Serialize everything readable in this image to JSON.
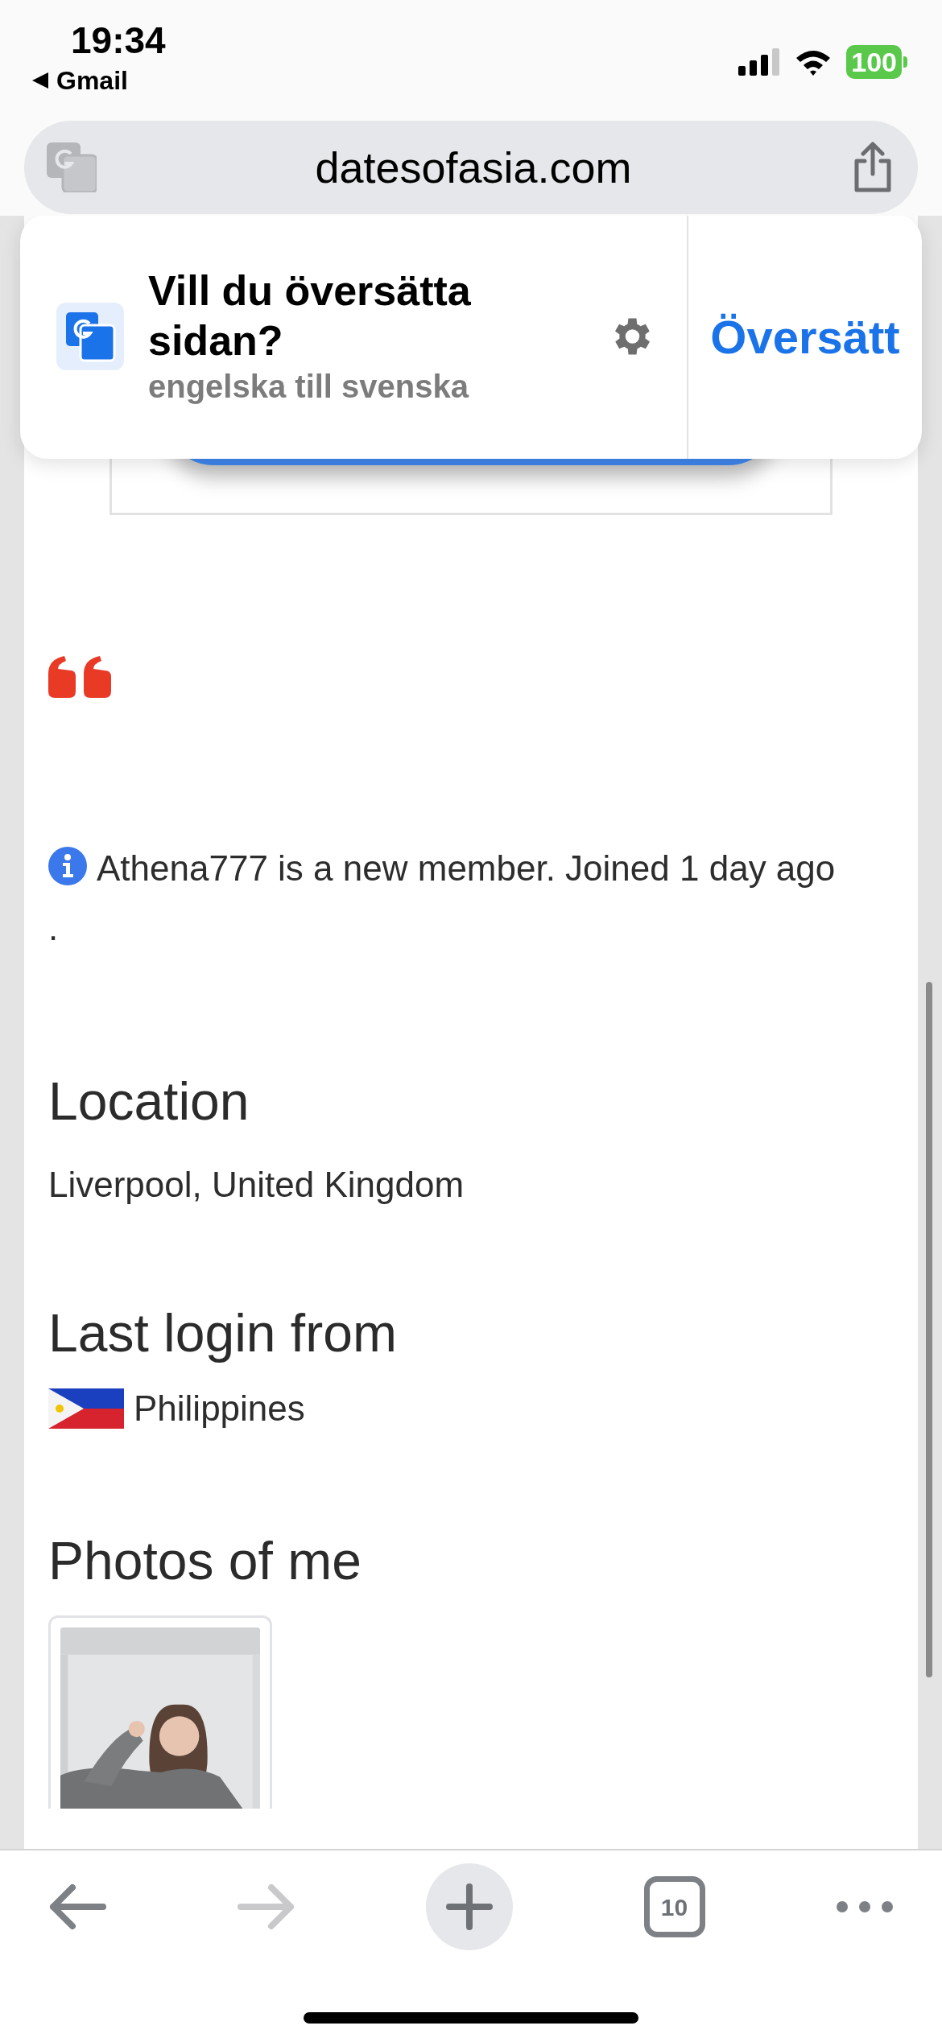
{
  "status_bar": {
    "time": "19:34",
    "back_app": "Gmail",
    "battery": "100"
  },
  "address_bar": {
    "url": "datesofasia.com"
  },
  "translate_prompt": {
    "title": "Vill du översätta sidan?",
    "subtitle": "engelska till svenska",
    "action": "Översätt"
  },
  "profile": {
    "notice": "Athena777 is a new member. Joined 1 day ago .",
    "location": {
      "heading": "Location",
      "value": "Liverpool, United Kingdom"
    },
    "last_login": {
      "heading": "Last login from",
      "country": "Philippines"
    },
    "photos": {
      "heading": "Photos of me"
    }
  },
  "toolbar": {
    "tab_count": "10",
    "forward_disabled": true
  }
}
